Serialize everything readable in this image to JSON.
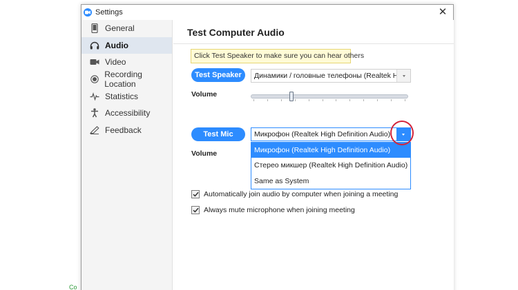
{
  "window": {
    "title": "Settings",
    "app_icon": "zoom-camera-icon",
    "close_glyph": "✕"
  },
  "sidebar": {
    "items": [
      {
        "label": "General",
        "icon": "phone-icon",
        "active": false
      },
      {
        "label": "Audio",
        "icon": "headphones-icon",
        "active": true
      },
      {
        "label": "Video",
        "icon": "video-camera-icon",
        "active": false
      },
      {
        "label": "Recording Location",
        "icon": "record-icon",
        "active": false
      },
      {
        "label": "Statistics",
        "icon": "pulse-icon",
        "active": false
      },
      {
        "label": "Accessibility",
        "icon": "accessibility-icon",
        "active": false
      },
      {
        "label": "Feedback",
        "icon": "feedback-icon",
        "active": false
      }
    ]
  },
  "audio": {
    "heading": "Test Computer Audio",
    "tooltip": "Click Test Speaker to make sure you can hear others",
    "speaker": {
      "button": "Test Speaker",
      "device": "Динамики / головные телефоны (Realtek High Definition Audio)",
      "volume_label": "Volume",
      "volume_level": 0.25
    },
    "mic": {
      "button": "Test Mic",
      "device": "Микрофон (Realtek High Definition Audio)",
      "volume_label": "Volume",
      "options": [
        "Микрофон (Realtek High Definition Audio)",
        "Стерео микшер (Realtek High Definition Audio)",
        "Same as System"
      ],
      "selected_index": 0
    },
    "options": {
      "auto_join": {
        "label": "Automatically join audio by computer when joining a meeting",
        "checked": true
      },
      "mute_mic": {
        "label": "Always mute microphone when joining meeting",
        "checked": true
      }
    }
  },
  "colors": {
    "accent": "#2d8cff",
    "highlight_circle": "#d3243a",
    "tooltip_bg": "#fffbd6",
    "sidebar_active": "#dfe6ef"
  },
  "background_fragment": "Co"
}
